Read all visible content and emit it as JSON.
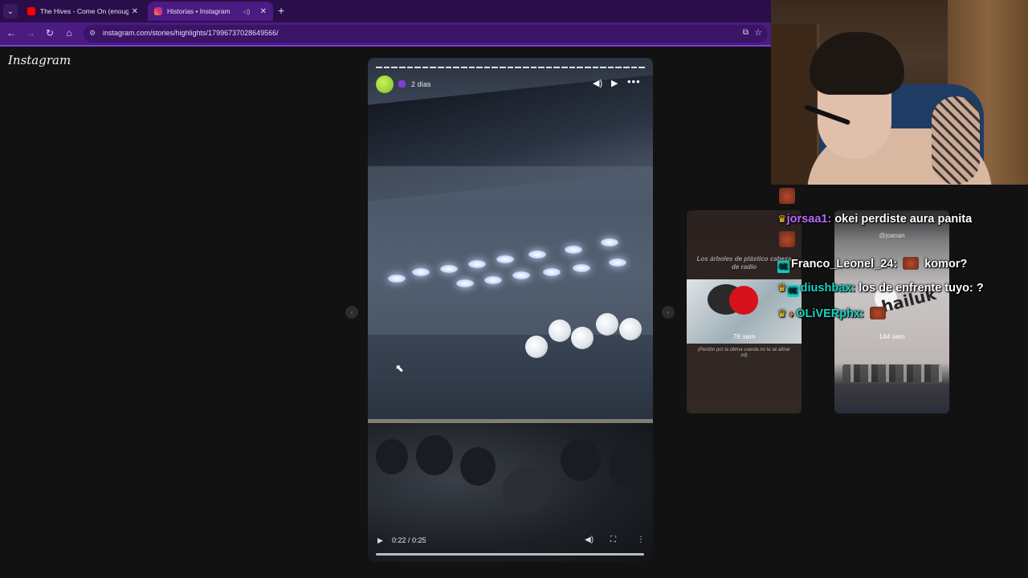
{
  "browser": {
    "tabs": [
      {
        "title": "The Hives - Come On (enough",
        "favicon_color": "#ff0000",
        "active": false
      },
      {
        "title": "Historias • Instagram",
        "favicon_color": "#e1306c",
        "active": true
      }
    ],
    "url": "instagram.com/stories/highlights/17996737028649566/",
    "theme_color": "#4b1b82"
  },
  "instagram": {
    "logo": "Instagram",
    "story": {
      "time_ago": "2 días",
      "segments": 35,
      "video_time": "0:22 / 0:25",
      "progress": 0.88
    },
    "previews": [
      {
        "heading": "Los árboles de plástico cabeza de radio",
        "time": "76 sem",
        "caption": "(Perdón por la última cuerda no la sé afinar xd)"
      },
      {
        "handle": "@joanan",
        "graffiti": "hailuk",
        "time": "144 sem"
      }
    ]
  },
  "chat": [
    {
      "user": "jorsaa1",
      "sep": ":",
      "message": "okei perdiste aura panita",
      "user_color": "#b66bff"
    },
    {
      "user": "Franco_Leonel_24",
      "sep": ":",
      "message": "komor?",
      "user_color": "#ffffff"
    },
    {
      "user": "diushbax",
      "sep": ":",
      "message": "los de enfrente tuyo: ?",
      "user_color": "#14d6c5"
    },
    {
      "user": "OLiVERphx",
      "sep": ":",
      "message": "",
      "user_color": "#14d6c5"
    }
  ],
  "icons": {
    "crown": "♛",
    "badge": "8E",
    "play": "▶",
    "mute": "🔈"
  }
}
